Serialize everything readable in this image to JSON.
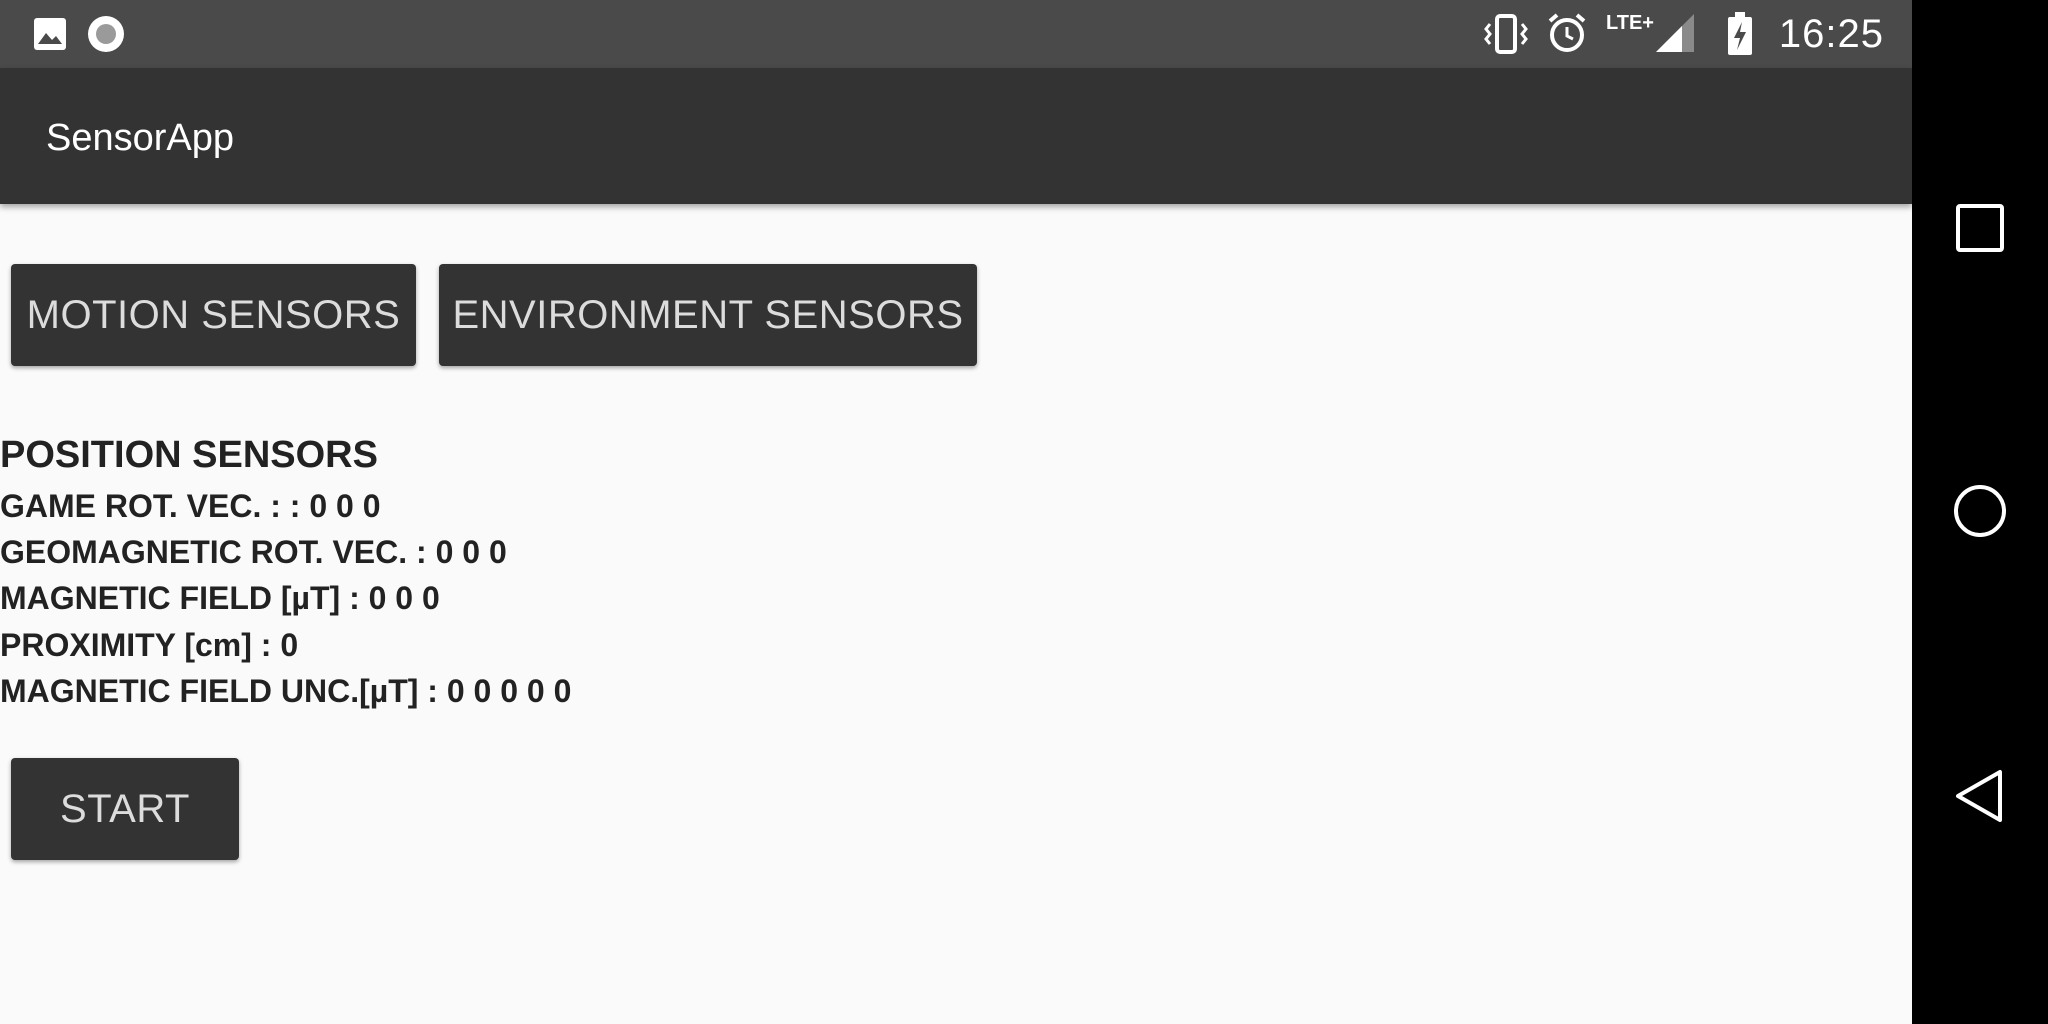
{
  "status_bar": {
    "time": "16:25",
    "network_label": "LTE+",
    "icons": [
      "image-icon",
      "record-icon",
      "vibrate-icon",
      "alarm-icon",
      "signal-icon",
      "battery-charging-icon"
    ]
  },
  "app_bar": {
    "title": "SensorApp"
  },
  "buttons": {
    "motion_label": "MOTION SENSORS",
    "environment_label": "ENVIRONMENT SENSORS",
    "start_label": "START"
  },
  "position_section": {
    "title": "POSITION SENSORS",
    "readings": [
      "GAME ROT. VEC. : : 0 0 0",
      "GEOMAGNETIC ROT. VEC. : 0 0 0",
      "MAGNETIC FIELD [µT] : 0 0 0",
      "PROXIMITY [cm] : 0",
      "MAGNETIC FIELD UNC.[µT] : 0 0 0 0 0"
    ]
  },
  "nav_bar": {
    "icons": [
      "recents-icon",
      "home-icon",
      "back-icon"
    ]
  },
  "colors": {
    "status_bar": "#4a4a4a",
    "app_bar": "#333333",
    "background": "#fafafa",
    "button": "#333333",
    "button_text": "#dcdcdc",
    "nav_bar": "#000000"
  }
}
